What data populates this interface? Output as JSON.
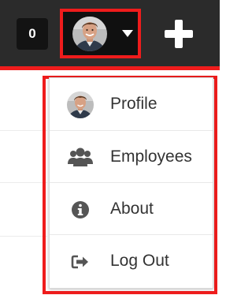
{
  "topbar": {
    "notification_count": "0"
  },
  "user_menu": {
    "items": [
      {
        "label": "Profile",
        "icon": "avatar-icon"
      },
      {
        "label": "Employees",
        "icon": "users-icon"
      },
      {
        "label": "About",
        "icon": "info-circle-icon"
      },
      {
        "label": "Log Out",
        "icon": "sign-out-icon"
      }
    ]
  },
  "colors": {
    "topbar_bg": "#2b2b2b",
    "highlight_red": "#ef1c1c",
    "menu_text": "#333333",
    "icon_gray": "#555555"
  }
}
